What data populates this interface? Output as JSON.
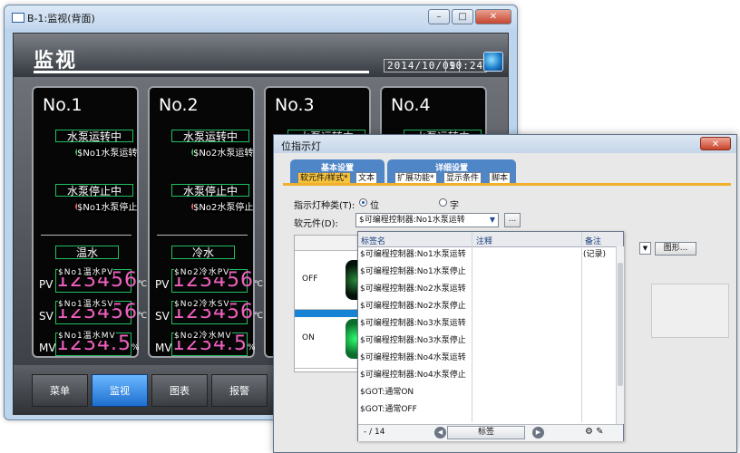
{
  "hmi_window": {
    "title": "B-1:监视(背面)",
    "controls": {
      "minimize": "–",
      "maximize": "□",
      "close": "✕"
    },
    "screen_title": "监视",
    "date": "2014/10/09",
    "time": "10:24",
    "panels": [
      {
        "number": "No.1",
        "run_label": "水泵运转中",
        "run_device": "$No1水泵运转",
        "stop_label": "水泵停止中",
        "stop_device": "$No1水泵停止",
        "medium": "温水",
        "pv_label": "PV",
        "pv_device": "$No1温水PV",
        "pv_value": "123456",
        "pv_unit": "℃",
        "sv_label": "SV",
        "sv_device": "$No1温水SV",
        "sv_value": "123456",
        "sv_unit": "℃",
        "mv_label": "MV",
        "mv_device": "$No1温水MV",
        "mv_value": "1234.5",
        "mv_unit": "%"
      },
      {
        "number": "No.2",
        "run_label": "水泵运转中",
        "run_device": "$No2水泵运转",
        "stop_label": "水泵停止中",
        "stop_device": "$No2水泵停止",
        "medium": "冷水",
        "pv_label": "PV",
        "pv_device": "$No2冷水PV",
        "pv_value": "123456",
        "pv_unit": "℃",
        "sv_label": "SV",
        "sv_device": "$No2冷水SV",
        "sv_value": "123456",
        "sv_unit": "℃",
        "mv_label": "MV",
        "mv_device": "$No2冷水MV",
        "mv_value": "1234.5",
        "mv_unit": "%"
      },
      {
        "number": "No.3",
        "run_label": "水泵运转中"
      },
      {
        "number": "No.4",
        "run_label": "水泵运转中"
      }
    ],
    "nav": [
      "菜单",
      "监视",
      "图表",
      "报警"
    ],
    "nav_active": 1
  },
  "dialog": {
    "title": "位指示灯",
    "close": "✕",
    "group_basic": "基本设置",
    "group_detail": "详细设置",
    "tabs_basic": [
      "软元件/样式*",
      "文本"
    ],
    "tabs_detail": [
      "扩展功能*",
      "显示条件",
      "脚本"
    ],
    "lamp_type_label": "指示灯种类(T):",
    "radio_bit": "位",
    "radio_word": "字",
    "device_label": "软元件(D):",
    "device_value": "$可编程控制器:No1水泵运转",
    "ellipsis": "...",
    "states": [
      "OFF",
      "ON"
    ],
    "shape_button": "图形...",
    "popup": {
      "headers": [
        "标签名",
        "注释",
        "备注"
      ],
      "rows": [
        {
          "name": "$可编程控制器:No1水泵运转",
          "note": "(记录)"
        },
        {
          "name": "$可编程控制器:No1水泵停止",
          "note": ""
        },
        {
          "name": "$可编程控制器:No2水泵运转",
          "note": ""
        },
        {
          "name": "$可编程控制器:No2水泵停止",
          "note": ""
        },
        {
          "name": "$可编程控制器:No3水泵运转",
          "note": ""
        },
        {
          "name": "$可编程控制器:No3水泵停止",
          "note": ""
        },
        {
          "name": "$可编程控制器:No4水泵运转",
          "note": ""
        },
        {
          "name": "$可编程控制器:No4水泵停止",
          "note": ""
        },
        {
          "name": "$GOT:通常ON",
          "note": ""
        },
        {
          "name": "$GOT:通常OFF",
          "note": ""
        }
      ],
      "count": "- / 14",
      "footer_button": "标签"
    }
  },
  "colors": {
    "accent_blue": "#1e6fd0",
    "tab_selected": "#f6c33e",
    "value_magenta": "#f060c0",
    "frame_green": "#1fbf60"
  }
}
